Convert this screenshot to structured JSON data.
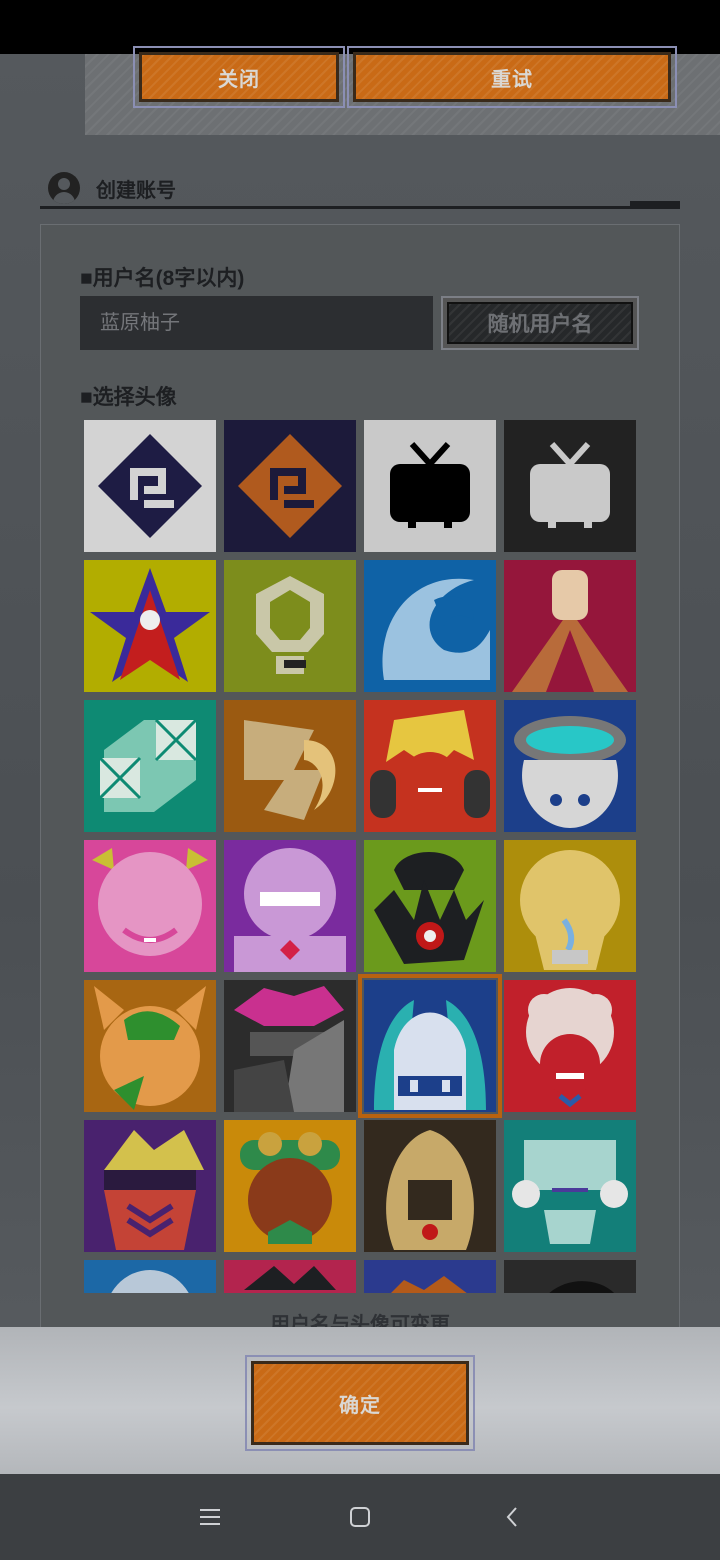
{
  "dialog": {
    "close_label": "关闭",
    "retry_label": "重试"
  },
  "section": {
    "title": "创建账号",
    "icon": "user-avatar-icon"
  },
  "form": {
    "username_label": "■用户名(8字以内)",
    "username_placeholder": "蓝原柚子",
    "random_button": "随机用户名",
    "avatar_label": "■选择头像",
    "note": "用户名与头像可变更",
    "confirm_label": "确定"
  },
  "avatars": {
    "selected_index": 18,
    "items": [
      {
        "name": "logo-blue",
        "bg": "#d3d3d3"
      },
      {
        "name": "logo-orange",
        "bg": "#1c1a3a"
      },
      {
        "name": "tv-dark",
        "bg": "#c9c9c9"
      },
      {
        "name": "tv-light",
        "bg": "#222222"
      },
      {
        "name": "star-emblem",
        "bg": "#b2ad00"
      },
      {
        "name": "lightbulb",
        "bg": "#7d8d1c"
      },
      {
        "name": "wave",
        "bg": "#0f62a6"
      },
      {
        "name": "volcano-fist",
        "bg": "#95163b"
      },
      {
        "name": "cube",
        "bg": "#0e8a73"
      },
      {
        "name": "flame-gun",
        "bg": "#9b5a11"
      },
      {
        "name": "headphones-girl",
        "bg": "#c5321f"
      },
      {
        "name": "goggles",
        "bg": "#1c3f8a"
      },
      {
        "name": "pink-girl",
        "bg": "#d7479a"
      },
      {
        "name": "glasses-girl",
        "bg": "#7a2b9e"
      },
      {
        "name": "hand-eye",
        "bg": "#6b9a1c"
      },
      {
        "name": "blonde-tear",
        "bg": "#ad8e0c"
      },
      {
        "name": "cat-ears",
        "bg": "#a86612"
      },
      {
        "name": "pink-hair-mask",
        "bg": "#2c2c2c"
      },
      {
        "name": "blue-twin",
        "bg": "#1c3f8a"
      },
      {
        "name": "white-hair",
        "bg": "#c1202b"
      },
      {
        "name": "purple-visor",
        "bg": "#49226e"
      },
      {
        "name": "goggle-cap",
        "bg": "#c98a0a"
      },
      {
        "name": "long-hair",
        "bg": "#33291e"
      },
      {
        "name": "flower-hair",
        "bg": "#137f79"
      },
      {
        "name": "partial-1",
        "bg": "#1c68a6"
      },
      {
        "name": "partial-2",
        "bg": "#b3244e"
      },
      {
        "name": "partial-3",
        "bg": "#2b3a8e"
      },
      {
        "name": "partial-4",
        "bg": "#2a2a2a"
      }
    ]
  },
  "navbar": {
    "menu_icon": "menu-icon",
    "home_icon": "home-icon",
    "back_icon": "back-icon"
  }
}
